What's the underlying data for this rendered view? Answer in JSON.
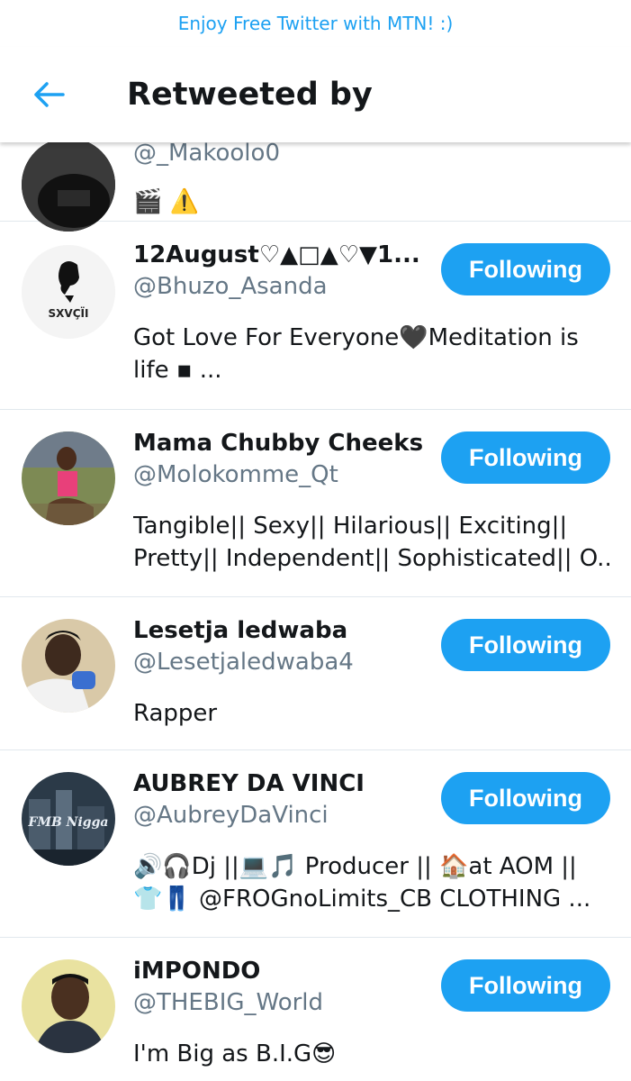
{
  "promo_banner": "Enjoy Free Twitter with MTN! :)",
  "header": {
    "back_icon": "arrow-left-icon",
    "title": "Retweeted by"
  },
  "colors": {
    "accent": "#1da1f2",
    "handle_gray": "#657786",
    "divider": "#e1e8ed"
  },
  "partial_user": {
    "handle": "@_Makoolo0",
    "bio": "🎬 ⚠️"
  },
  "users": [
    {
      "name": "12August♡▲□▲♡▼1...",
      "handle": "@Bhuzo_Asanda",
      "bio_line1": "Got Love For Everyone🖤Meditation is",
      "bio_line2": "life ▪ ...",
      "button": "Following",
      "avatar_text": "SXVÇÏI"
    },
    {
      "name": "Mama Chubby Cheeks",
      "handle": "@Molokomme_Qt",
      "bio_line1": "Tangible|| Sexy|| Hilarious|| Exciting||",
      "bio_line2": "Pretty|| Independent|| Sophisticated|| O...",
      "button": "Following"
    },
    {
      "name": "Lesetja ledwaba",
      "handle": "@Lesetjaledwaba4",
      "bio_line1": "Rapper",
      "bio_line2": "",
      "button": "Following"
    },
    {
      "name": "AUBREY DA VINCI",
      "handle": "@AubreyDaVinci",
      "bio_line1": "🔊🎧Dj ||💻🎵 Producer || 🏠at AOM ||",
      "bio_line2": "👕👖 @FROGnoLimits_CB CLOTHING ...",
      "button": "Following",
      "avatar_text": "FMB Nigga"
    },
    {
      "name": "iMPONDO",
      "handle": "@THEBIG_World",
      "bio_line1": "I'm Big as B.I.G😎",
      "bio_line2": "",
      "button": "Following"
    }
  ]
}
